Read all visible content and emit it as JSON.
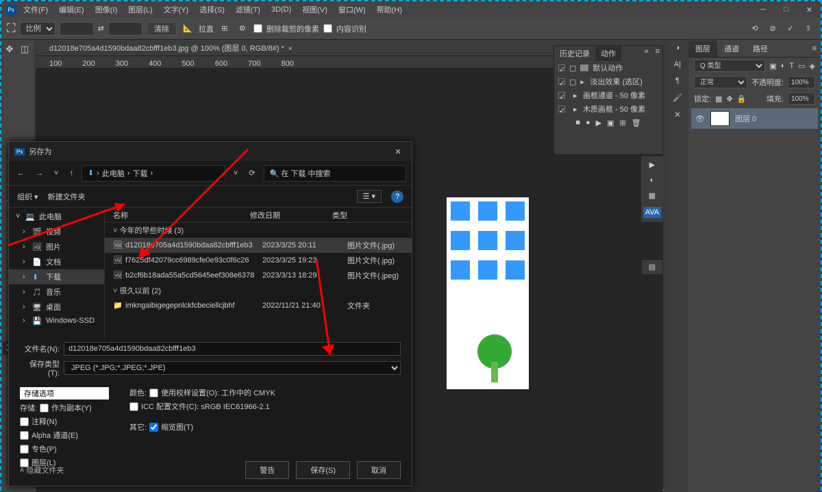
{
  "menu": {
    "items": [
      "文件(F)",
      "编辑(E)",
      "图像(I)",
      "图层(L)",
      "文字(Y)",
      "选择(S)",
      "滤镜(T)",
      "3D(D)",
      "视图(V)",
      "窗口(W)",
      "帮助(H)"
    ]
  },
  "optbar": {
    "ratio": "比例",
    "clear": "清除",
    "label1": "拉直",
    "cb1": "删除裁剪的像素",
    "cb2": "内容识别"
  },
  "tab": {
    "title": "d12018e705a4d1590bdaa82cbfff1eb3.jpg @ 100% (图层 0, RGB/8#) *"
  },
  "ruler": [
    "100",
    "200",
    "300",
    "400",
    "500",
    "600",
    "700",
    "800"
  ],
  "history_panel": {
    "tabs": [
      "历史记录",
      "动作"
    ],
    "items": [
      "默认动作",
      "淡出效果 (选区)",
      "画框通道 - 50 像素",
      "木质画框 - 50 像素"
    ]
  },
  "layers_panel": {
    "tabs": [
      "图层",
      "通道",
      "路径"
    ],
    "type": "Q 类型",
    "mode": "正常",
    "opacity_label": "不透明度:",
    "opacity": "100%",
    "lock": "锁定:",
    "fill_label": "填充:",
    "fill": "100%",
    "layer": "图层 0"
  },
  "dialog": {
    "title": "另存为",
    "path": [
      "此电脑",
      "下载"
    ],
    "search_ph": "在 下载 中搜索",
    "toolbar": [
      "组织",
      "新建文件夹"
    ],
    "side": [
      {
        "label": "此电脑",
        "ico": "💻",
        "top": true
      },
      {
        "label": "视频",
        "ico": "🎬"
      },
      {
        "label": "图片",
        "ico": "🖼"
      },
      {
        "label": "文档",
        "ico": "📄"
      },
      {
        "label": "下载",
        "ico": "⬇",
        "sel": true
      },
      {
        "label": "音乐",
        "ico": "🎵"
      },
      {
        "label": "桌面",
        "ico": "🖥"
      },
      {
        "label": "Windows-SSD",
        "ico": "💾"
      }
    ],
    "cols": [
      "名称",
      "修改日期",
      "类型"
    ],
    "group1": "今年的早些时候 (3)",
    "files": [
      {
        "name": "d12018e705a4d1590bdaa82cbfff1eb3",
        "date": "2023/3/25 20:11",
        "type": "图片文件(.jpg)",
        "sel": true,
        "ico": "🖼"
      },
      {
        "name": "f7625df42079cc6989cfe0e93c0f6c26",
        "date": "2023/3/25 19:23",
        "type": "图片文件(.jpg)",
        "ico": "🖼"
      },
      {
        "name": "b2cf6b18ada55a5cd5645eef308e6378",
        "date": "2023/3/13 18:29",
        "type": "图片文件(.jpeg)",
        "ico": "🖼"
      }
    ],
    "group2": "很久以前 (2)",
    "files2": [
      {
        "name": "imkngaibigegepnlckfcbeciellcjbhf",
        "date": "2022/11/21 21:40",
        "type": "文件夹",
        "ico": "📁"
      }
    ],
    "filename_label": "文件名(N):",
    "filename": "d12018e705a4d1590bdaa82cbfff1eb3",
    "type_label": "保存类型(T):",
    "type": "JPEG (*.JPG;*.JPEG;*.JPE)",
    "opts_hdr": "存储选项",
    "opts_save": "存储:",
    "opts": [
      "作为副本(Y)",
      "注释(N)",
      "Alpha 通道(E)",
      "专色(P)",
      "图层(L)"
    ],
    "color_label": "颜色:",
    "color1": "使用校样设置(O): 工作中的 CMYK",
    "color2": "ICC 配置文件(C): sRGB IEC61966-2.1",
    "other_label": "其它:",
    "other1": "缩览图(T)",
    "hidden": "隐藏文件夹",
    "btn_warn": "警告",
    "btn_save": "保存(S)",
    "btn_cancel": "取消"
  }
}
